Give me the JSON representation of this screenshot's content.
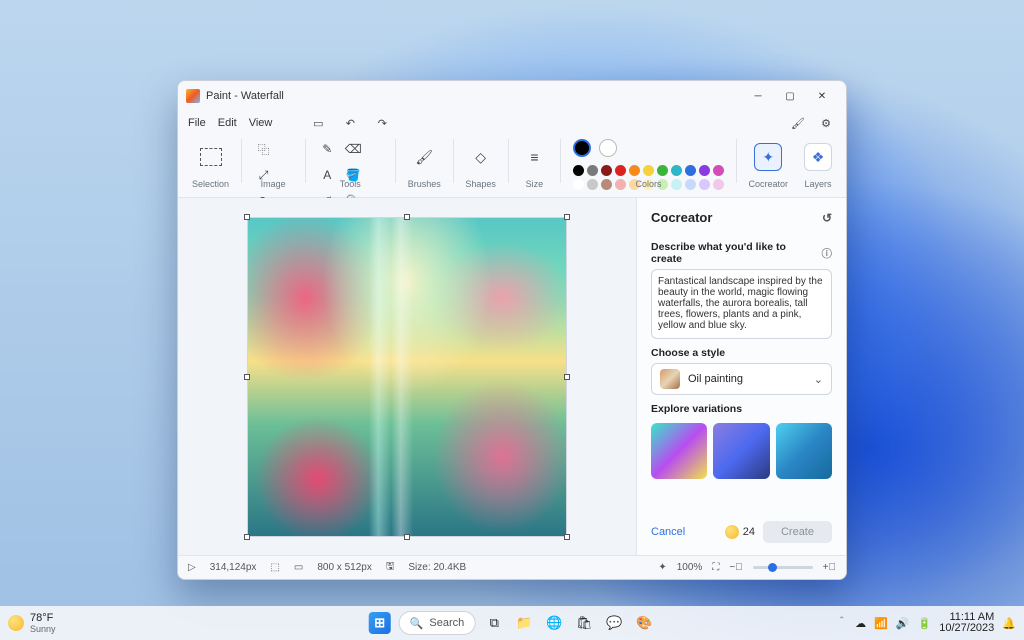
{
  "window": {
    "title": "Paint - Waterfall",
    "menus": {
      "file": "File",
      "edit": "Edit",
      "view": "View"
    }
  },
  "ribbon": {
    "selection": "Selection",
    "image": "Image",
    "tools": "Tools",
    "brushes": "Brushes",
    "shapes": "Shapes",
    "size": "Size",
    "colors": "Colors",
    "cocreator": "Cocreator",
    "layers": "Layers"
  },
  "palette_row1": [
    "#000000",
    "#7a7a7a",
    "#8a1a1a",
    "#d22",
    "#f58a1a",
    "#f5d23a",
    "#3ab53a",
    "#2eb5c8",
    "#2e6fe0",
    "#8a3ae0",
    "#d24db5"
  ],
  "palette_row2": [
    "#ffffff",
    "#c8c8c8",
    "#b88a7a",
    "#f5b0b0",
    "#ffd8a0",
    "#fff1b0",
    "#c8f1b0",
    "#c8f1f1",
    "#c8d8ff",
    "#d8c8ff",
    "#f1c8e8"
  ],
  "cocreator": {
    "title": "Cocreator",
    "describe_label": "Describe what you'd like to create",
    "prompt": "Fantastical landscape inspired by the beauty in the world, magic flowing waterfalls, the aurora borealis, tall trees, flowers, plants and a pink, yellow and blue sky.",
    "style_label": "Choose a style",
    "style_value": "Oil painting",
    "variations_label": "Explore variations",
    "cancel": "Cancel",
    "credits": "24",
    "create": "Create"
  },
  "status": {
    "cursor": "314,124px",
    "dimensions": "800  x  512px",
    "size_label": "Size: 20.4KB",
    "zoom": "100%"
  },
  "taskbar": {
    "temp": "78°F",
    "cond": "Sunny",
    "search": "Search",
    "time": "11:11 AM",
    "date": "10/27/2023"
  }
}
